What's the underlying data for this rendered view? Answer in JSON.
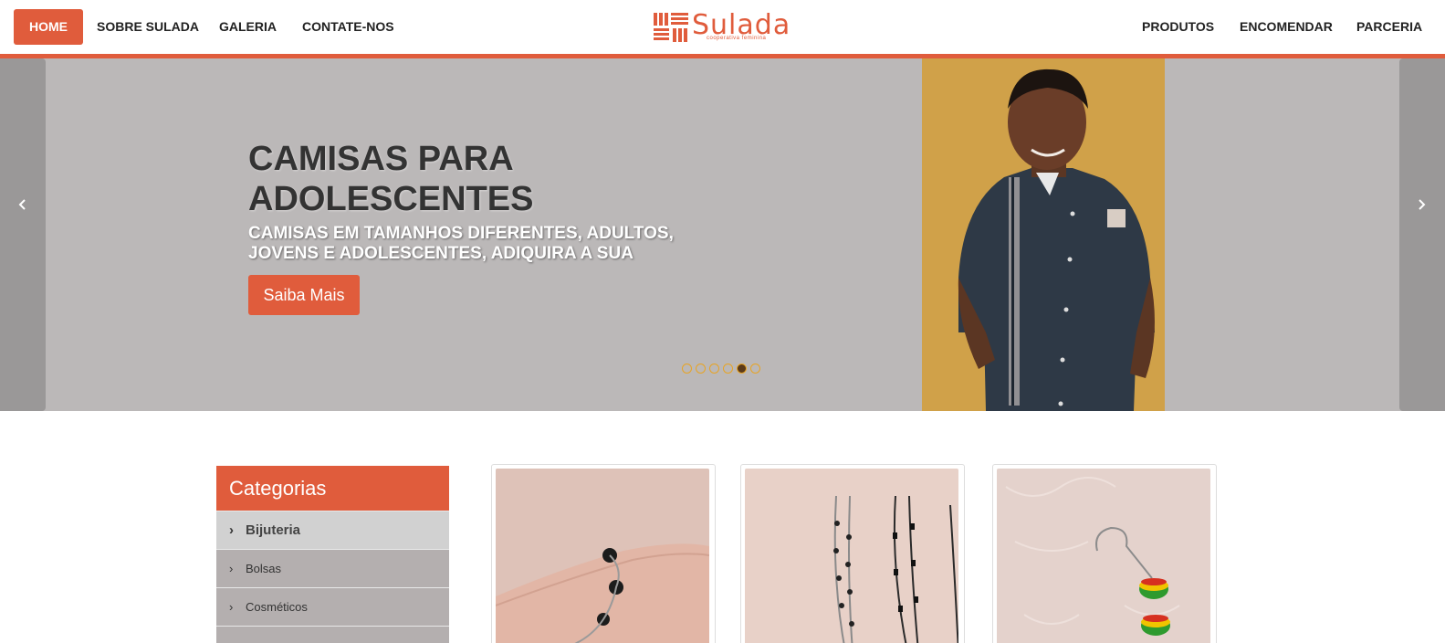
{
  "header": {
    "brand": {
      "name": "Sulada",
      "tagline": "cooperativa feminina",
      "logo_icon": "woven-pattern-icon"
    },
    "nav_left": [
      {
        "label": "HOME",
        "active": true
      },
      {
        "label": "SOBRE SULADA"
      },
      {
        "label": "GALERIA"
      },
      {
        "label": "CONTATE-NOS"
      }
    ],
    "nav_right": [
      {
        "label": "PRODUTOS"
      },
      {
        "label": "ENCOMENDAR"
      },
      {
        "label": "PARCERIA"
      }
    ],
    "accent_color": "#e05c3c"
  },
  "slider": {
    "title": "CAMISAS PARA ADOLESCENTES",
    "subtitle": "CAMISAS EM TAMANHOS DIFERENTES, ADULTOS, JOVENS E ADOLESCENTES, ADIQUIRA A SUA",
    "button_label": "Saiba Mais",
    "prev_icon": "chevron-left-icon",
    "next_icon": "chevron-right-icon",
    "slide_count": 6,
    "active_slide": 5,
    "photo": "boy-in-dark-shirt-photo"
  },
  "sidebar": {
    "title": "Categorias",
    "items": [
      {
        "label": "Bijuteria",
        "active": true
      },
      {
        "label": "Bolsas"
      },
      {
        "label": "Cosméticos"
      }
    ]
  },
  "products": [
    {
      "image": "bracelet-on-wrist-photo"
    },
    {
      "image": "necklaces-photo"
    },
    {
      "image": "rasta-bead-earring-photo"
    }
  ]
}
